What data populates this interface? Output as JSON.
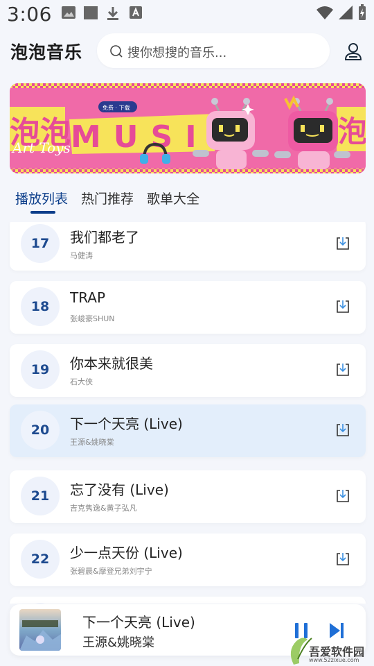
{
  "status_bar": {
    "time": "3:06"
  },
  "header": {
    "app_title": "泡泡音乐",
    "search_placeholder": "搜你想搜的音乐..."
  },
  "banner": {
    "word_music": "MUSIC",
    "word_left": "泡泡",
    "word_right": "泡",
    "script_text": "Art Toys",
    "badge": "免费 · 下载"
  },
  "tabs": [
    {
      "label": "播放列表",
      "active": true
    },
    {
      "label": "热门推荐",
      "active": false
    },
    {
      "label": "歌单大全",
      "active": false
    }
  ],
  "songs": [
    {
      "num": "17",
      "title": "我们都老了",
      "artist": "马健涛",
      "active": false
    },
    {
      "num": "18",
      "title": "TRAP",
      "artist": "张峻豪SHUN",
      "active": false
    },
    {
      "num": "19",
      "title": "你本来就很美",
      "artist": "石大侠",
      "active": false
    },
    {
      "num": "20",
      "title": "下一个天亮 (Live)",
      "artist": "王源&姚晓棠",
      "active": true
    },
    {
      "num": "21",
      "title": "忘了没有 (Live)",
      "artist": "吉克隽逸&黄子弘凡",
      "active": false
    },
    {
      "num": "22",
      "title": "少一点天份 (Live)",
      "artist": "张碧晨&摩登兄弟刘宇宁",
      "active": false
    }
  ],
  "player": {
    "title": "下一个天亮 (Live)",
    "artist": "王源&姚晓棠"
  },
  "watermark": {
    "name": "吾爱软件园",
    "url": "www.52zixue.com"
  },
  "colors": {
    "accent": "#0c3e8a",
    "active_row": "#e3eefb",
    "banner_pink": "#f06aa8",
    "banner_yellow": "#f7e35a"
  }
}
